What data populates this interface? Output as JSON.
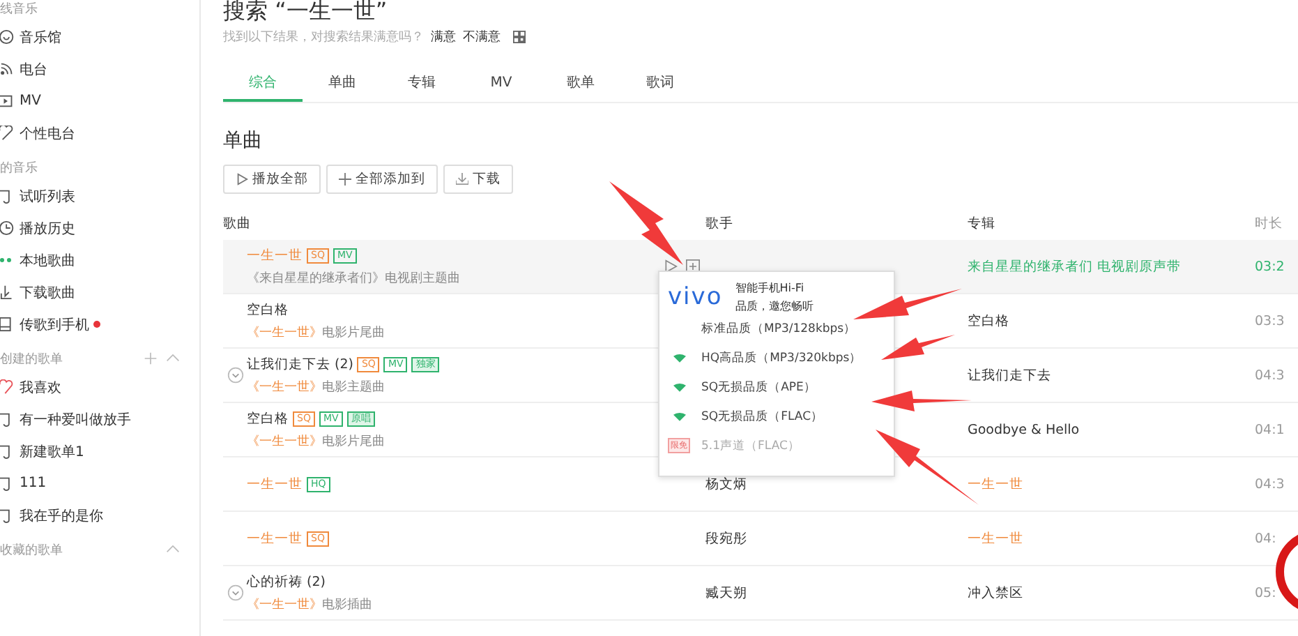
{
  "sidebar": {
    "sections": [
      {
        "title": "线音乐",
        "items": [
          {
            "label": "音乐馆",
            "dot": false
          },
          {
            "label": "电台",
            "dot": false
          },
          {
            "label": "MV",
            "dot": false
          },
          {
            "label": "个性电台",
            "dot": false
          }
        ]
      },
      {
        "title": "的音乐",
        "items": [
          {
            "label": "试听列表",
            "dot": false
          },
          {
            "label": "播放历史",
            "dot": false
          },
          {
            "label": "本地歌曲",
            "dot": false
          },
          {
            "label": "下载歌曲",
            "dot": false
          },
          {
            "label": "传歌到手机",
            "dot": true
          }
        ]
      },
      {
        "title": "创建的歌单",
        "items": [
          {
            "label": "我喜欢",
            "dot": false
          },
          {
            "label": "有一种爱叫做放手",
            "dot": false
          },
          {
            "label": "新建歌单1",
            "dot": false
          },
          {
            "label": "111",
            "dot": false
          },
          {
            "label": "我在乎的是你",
            "dot": false
          }
        ]
      },
      {
        "title": "收藏的歌单"
      }
    ]
  },
  "search": {
    "title": "搜索 “一生一世”",
    "prompt": "找到以下结果，对搜索结果满意吗？",
    "feedback": [
      "满意",
      "不满意"
    ]
  },
  "tabs": [
    {
      "label": "综合",
      "selected": true
    },
    {
      "label": "单曲",
      "selected": false
    },
    {
      "label": "专辑",
      "selected": false
    },
    {
      "label": "MV",
      "selected": false
    },
    {
      "label": "歌单",
      "selected": false
    },
    {
      "label": "歌词",
      "selected": false
    }
  ],
  "section_title": "单曲",
  "toolbar": [
    "播放全部",
    "全部添加到",
    "下载"
  ],
  "table": {
    "columns": [
      "歌曲",
      "歌手",
      "专辑",
      "时长"
    ],
    "rows": [
      {
        "title": "一生一世",
        "match": true,
        "expandable": false,
        "selected": true,
        "tags": [
          {
            "label": "SQ",
            "kind": "outline-orange"
          },
          {
            "label": "MV",
            "kind": "outline-green"
          }
        ],
        "source": "《来自星星的继承者们》",
        "source_match": false,
        "note": "电视剧主题曲",
        "album": "来自星星的继承者们 电视剧原声带",
        "album_match": false,
        "duration": "03:2"
      },
      {
        "title": "空白格",
        "match": false,
        "expandable": false,
        "selected": false,
        "source": "《一生一世》",
        "source_match": true,
        "note": "电影片尾曲",
        "album": "空白格",
        "album_match": false,
        "duration": "03:3"
      },
      {
        "title": "让我们走下去 (2)",
        "match": false,
        "expandable": true,
        "selected": false,
        "tags": [
          {
            "label": "SQ",
            "kind": "outline-orange"
          },
          {
            "label": "MV",
            "kind": "outline-green"
          },
          {
            "label": "独家",
            "kind": "fill-green"
          }
        ],
        "source": "《一生一世》",
        "source_match": true,
        "note": "电影主题曲",
        "album": "让我们走下去",
        "album_match": false,
        "duration": "04:3"
      },
      {
        "title": "空白格",
        "match": false,
        "expandable": false,
        "selected": false,
        "tags": [
          {
            "label": "SQ",
            "kind": "outline-orange"
          },
          {
            "label": "MV",
            "kind": "outline-green"
          },
          {
            "label": "原唱",
            "kind": "fill-green"
          }
        ],
        "source": "《一生一世》",
        "source_match": true,
        "note": "电影片尾曲",
        "album": "Goodbye & Hello",
        "album_match": false,
        "duration": "04:1"
      },
      {
        "title": "一生一世",
        "match": true,
        "expandable": false,
        "selected": false,
        "tags": [
          {
            "label": "HQ",
            "kind": "outline-green"
          }
        ],
        "singer": "杨文炳",
        "album": "一生一世",
        "album_match": true,
        "duration": "04:3"
      },
      {
        "title": "一生一世",
        "match": true,
        "expandable": false,
        "selected": false,
        "tags": [
          {
            "label": "SQ",
            "kind": "outline-orange"
          }
        ],
        "singer": "段宛彤",
        "album": "一生一世",
        "album_match": true,
        "duration": "04:"
      },
      {
        "title": "心的祈祷 (2)",
        "match": false,
        "expandable": true,
        "selected": false,
        "source": "《一生一世》",
        "source_match": true,
        "note": "电影插曲",
        "singer": "臧天朔",
        "album": "冲入禁区",
        "album_match": false,
        "duration": "05:"
      }
    ]
  },
  "popup": {
    "brand": "vivo",
    "slogan": [
      "智能手机Hi-Fi",
      "品质，邀您畅听"
    ],
    "options": [
      {
        "label": "标准品质（MP3/128kbps）",
        "kind": "plain",
        "disabled": false
      },
      {
        "label": "HQ高品质（MP3/320kbps）",
        "kind": "wifi",
        "disabled": false
      },
      {
        "label": "SQ无损品质（APE）",
        "kind": "wifi",
        "disabled": false
      },
      {
        "label": "SQ无损品质（FLAC）",
        "kind": "wifi",
        "disabled": false
      },
      {
        "label": "5.1声道（FLAC）",
        "kind": "badge",
        "badge": "限免",
        "disabled": true
      }
    ]
  }
}
